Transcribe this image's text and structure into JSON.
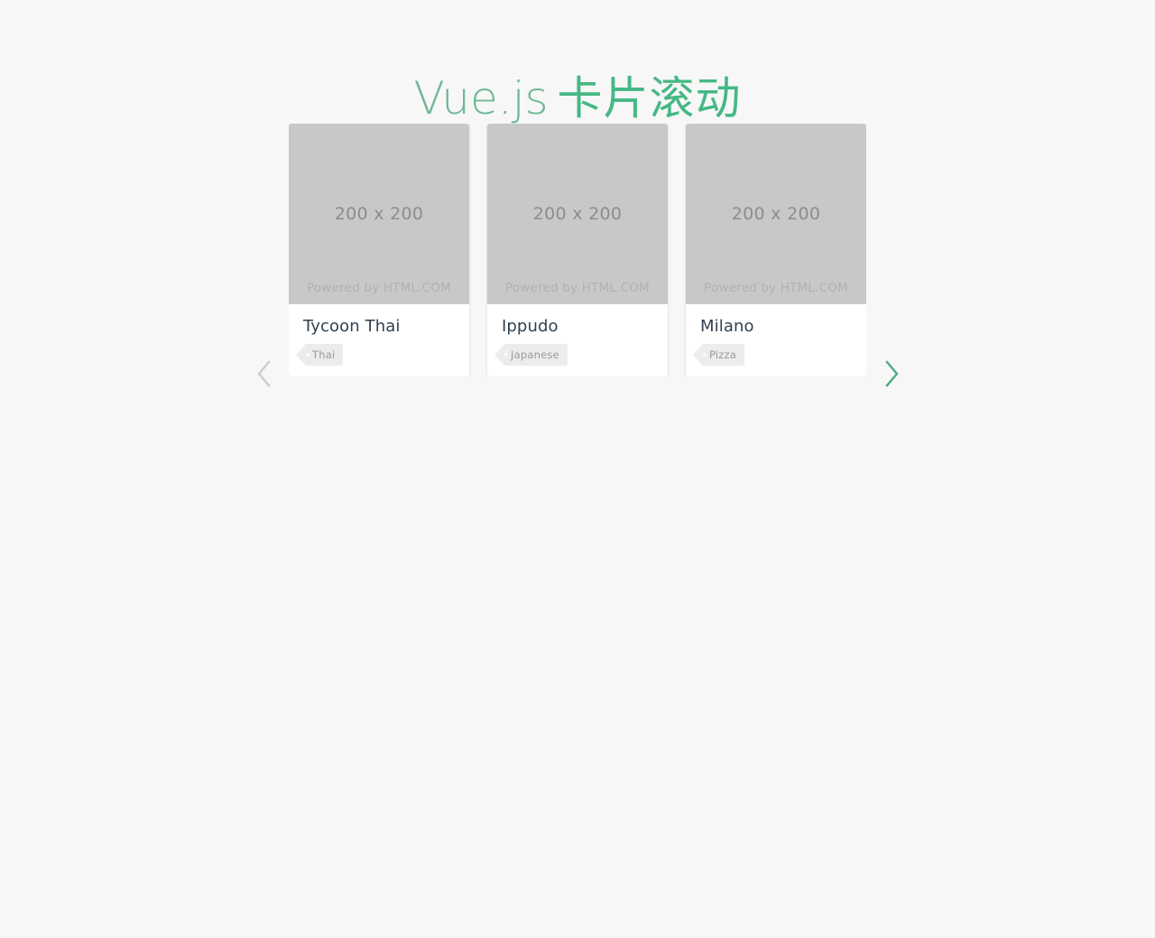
{
  "page": {
    "background_color": "#f7f7f7",
    "title_latin": "Vue.js",
    "title_cjk": "卡片滚动",
    "title_latin_color": "#6fb795",
    "title_cjk_color": "#45b884"
  },
  "carousel": {
    "prev_label": "chevron-left",
    "next_label": "chevron-right",
    "prev_enabled": false,
    "next_enabled": true,
    "prev_color": "#cdcdcd",
    "next_color": "#4fac7f",
    "cards": [
      {
        "media_size": "200 x 200",
        "media_credit": "Powered by HTML.COM",
        "title": "Tycoon Thai",
        "tag": "Thai"
      },
      {
        "media_size": "200 x 200",
        "media_credit": "Powered by HTML.COM",
        "title": "Ippudo",
        "tag": "Japanese"
      },
      {
        "media_size": "200 x 200",
        "media_credit": "Powered by HTML.COM",
        "title": "Milano",
        "tag": "Pizza"
      }
    ]
  }
}
